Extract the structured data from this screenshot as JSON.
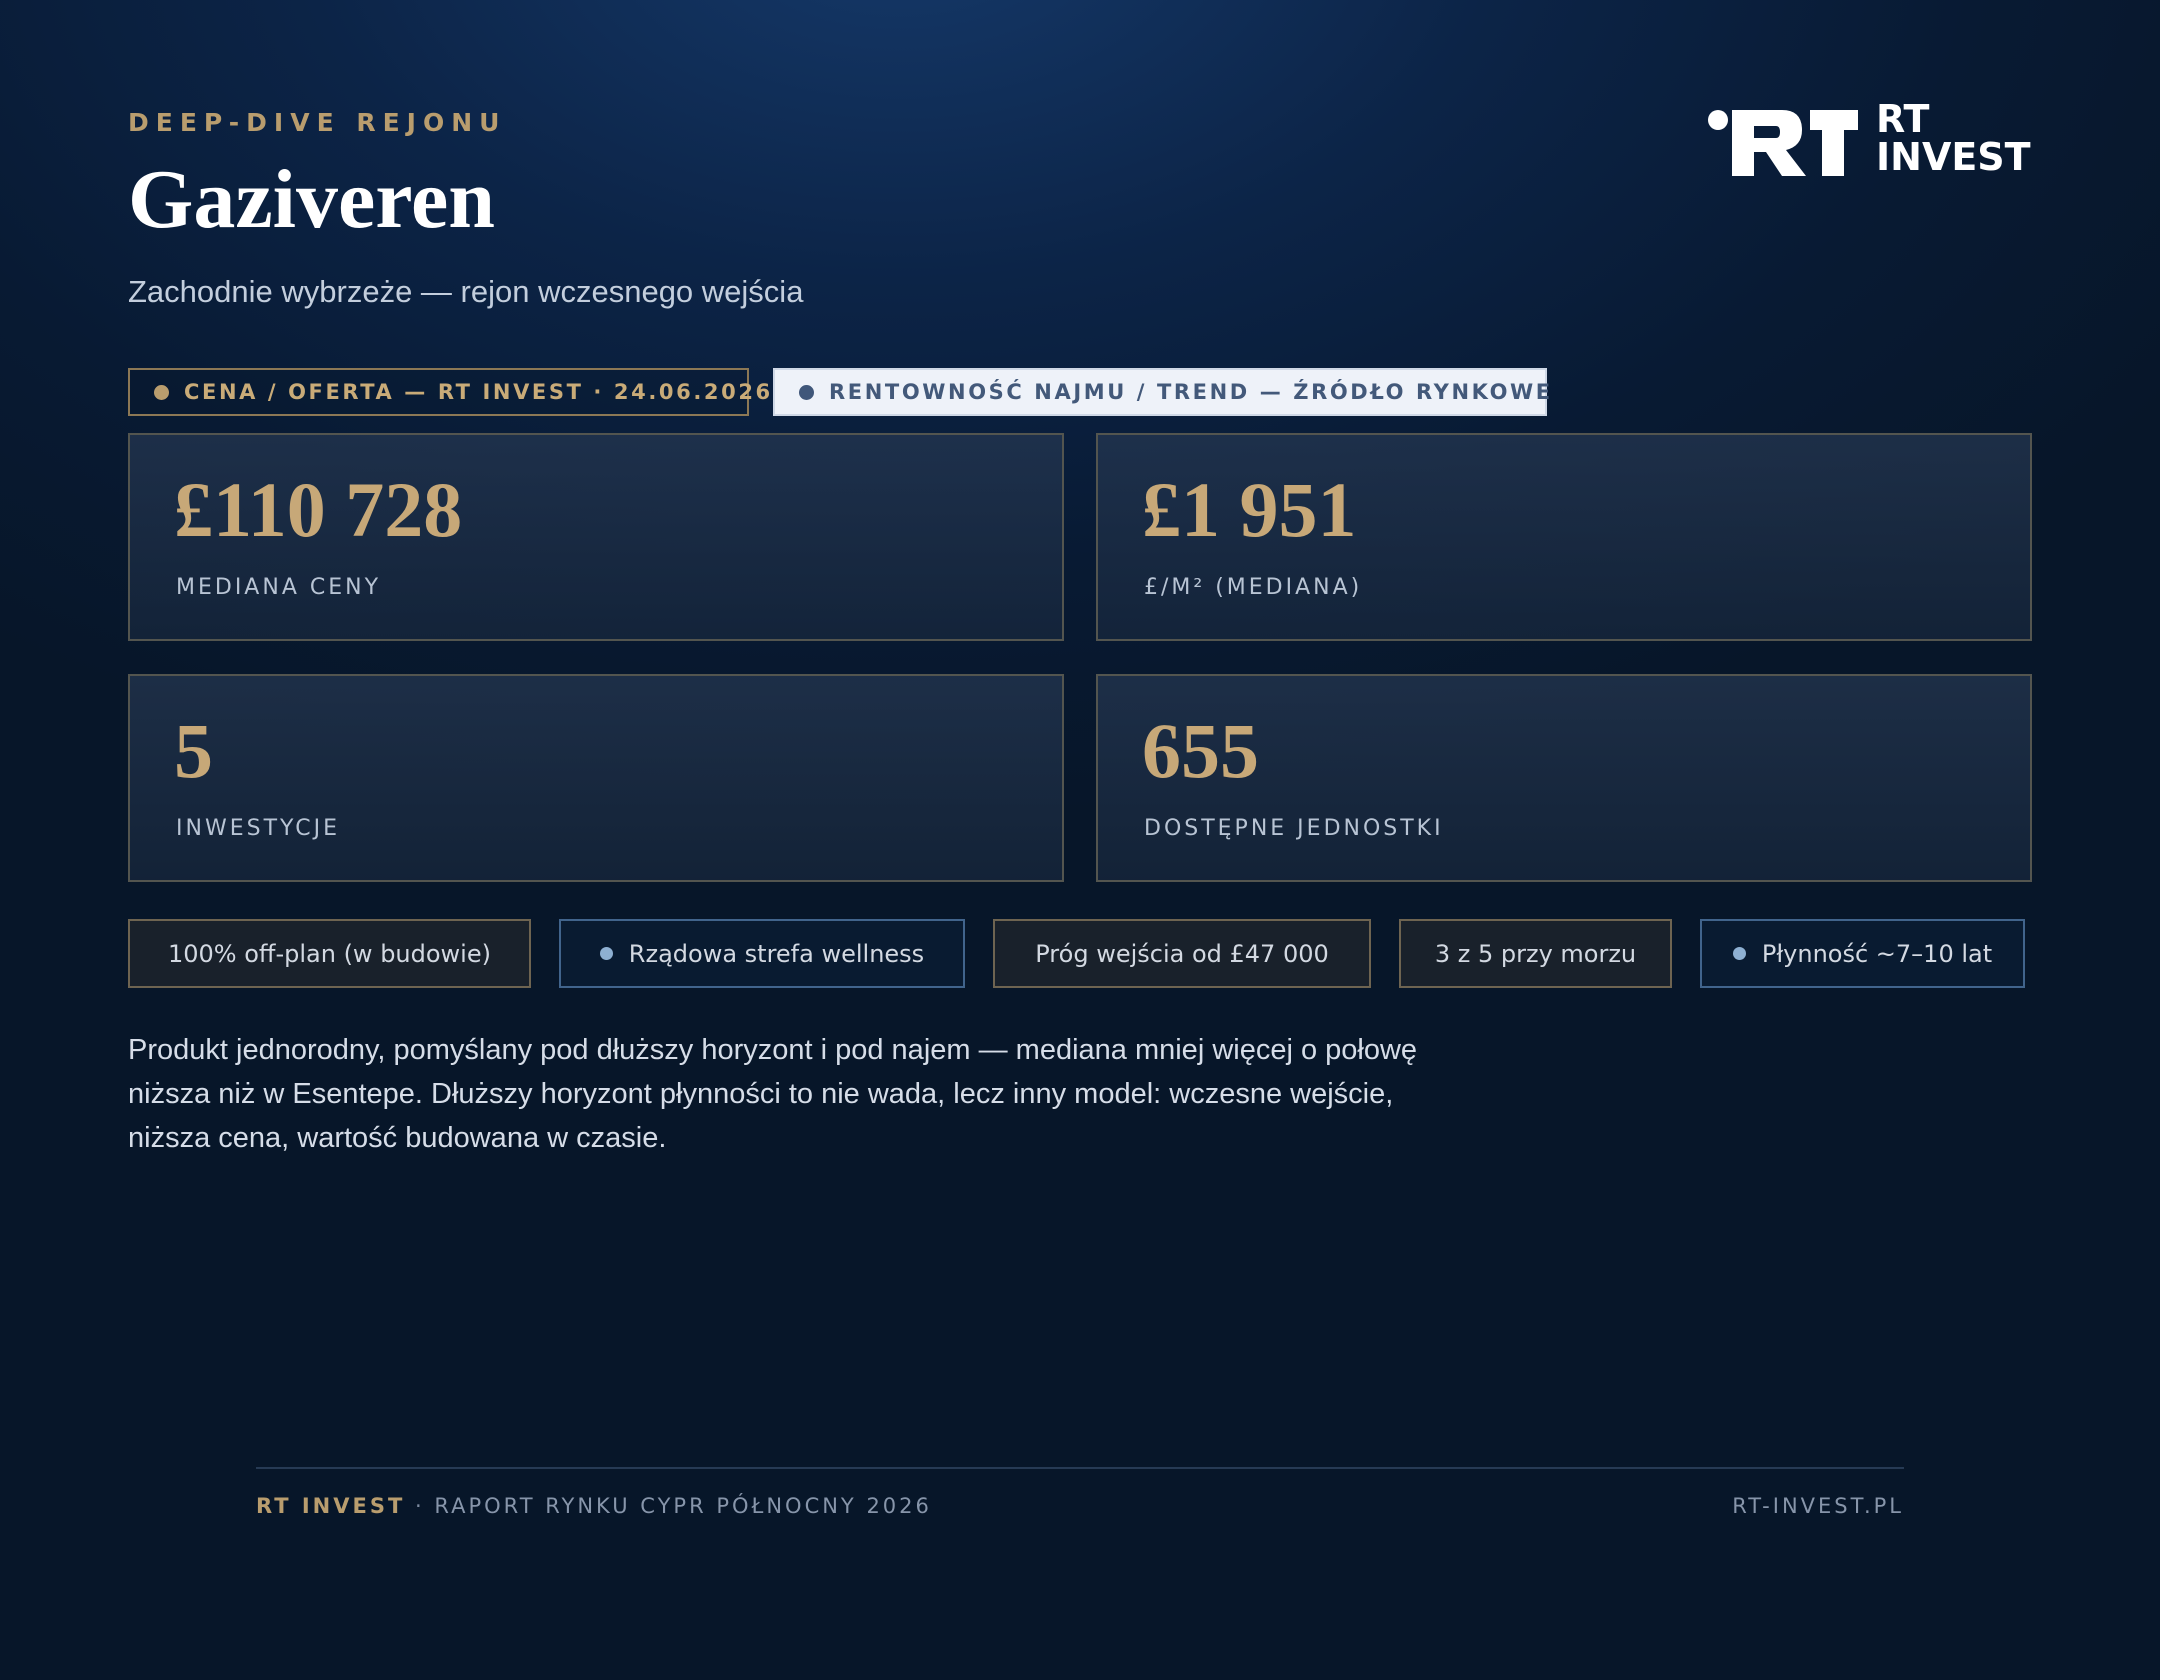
{
  "header": {
    "eyebrow": "DEEP-DIVE REJONU",
    "title": "Gaziveren",
    "subtitle": "Zachodnie wybrzeże — rejon wczesnego wejścia"
  },
  "logo": {
    "line1": "RT",
    "line2": "INVEST"
  },
  "tags": {
    "price": "CENA / OFERTA — RT INVEST · 24.06.2026",
    "rent": "RENTOWNOŚĆ NAJMU / TREND — ŹRÓDŁO RYNKOWE"
  },
  "stats": [
    {
      "value": "£110 728",
      "label": "MEDIANA CENY"
    },
    {
      "value": "£1 951",
      "label": "£/M² (MEDIANA)"
    },
    {
      "value": "5",
      "label": "INWESTYCJE"
    },
    {
      "value": "655",
      "label": "DOSTĘPNE JEDNOSTKI"
    }
  ],
  "chips": [
    {
      "label": "100% off-plan (w budowie)"
    },
    {
      "label": "Rządowa strefa wellness"
    },
    {
      "label": "Próg wejścia od £47 000"
    },
    {
      "label": "3 z 5 przy morzu"
    },
    {
      "label": "Płynność ~7–10 lat"
    }
  ],
  "description": "Produkt jednorodny, pomyślany pod dłuższy horyzont i pod najem — mediana mniej więcej o połowę niższa niż w Esentepe. Dłuższy horyzont płynności to nie wada, lecz inny model: wczesne wejście, niższa cena, wartość budowana w czasie.",
  "footer": {
    "brand": "RT INVEST",
    "separator": "·",
    "report": "RAPORT RYNKU CYPR PÓŁNOCNY 2026",
    "url": "RT-INVEST.PL"
  },
  "colors": {
    "accent_gold": "#b99d6e",
    "background": "#0c2447",
    "chip_blue_border": "#41648c"
  }
}
